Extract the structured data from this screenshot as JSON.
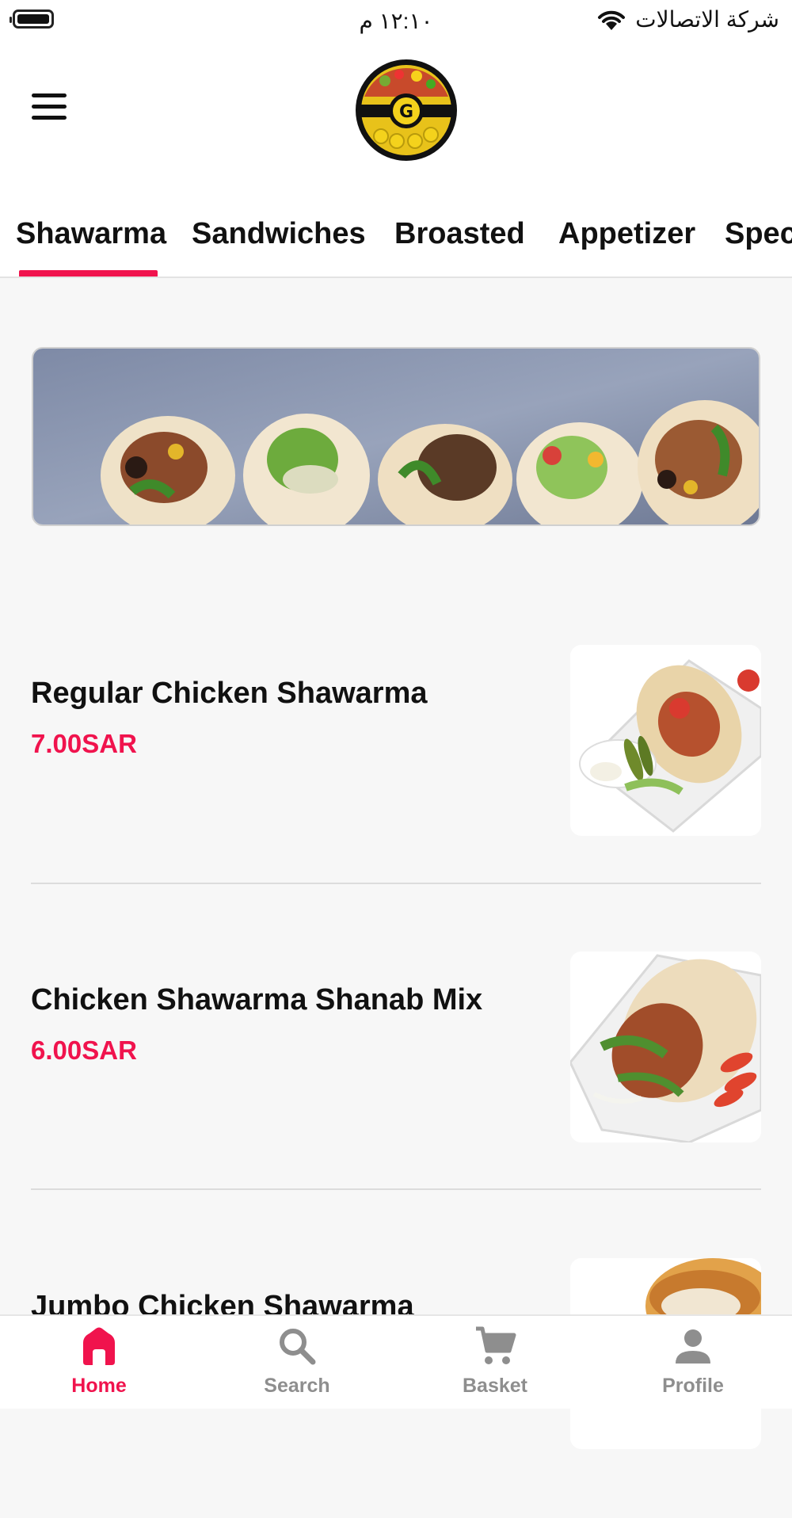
{
  "status_bar": {
    "carrier": "شركة الاتصالات",
    "time": "١٢:١٠ م"
  },
  "header": {
    "menu_icon": "hamburger-icon",
    "logo": "restaurant-logo"
  },
  "tabs": [
    {
      "label": "Shawarma",
      "active": true
    },
    {
      "label": "Sandwiches",
      "active": false
    },
    {
      "label": "Broasted",
      "active": false
    },
    {
      "label": "Appetizer",
      "active": false
    },
    {
      "label": "Spec",
      "active": false
    }
  ],
  "menu_items": [
    {
      "name": "Regular Chicken Shawarma",
      "price": "7.00SAR"
    },
    {
      "name": "Chicken Shawarma Shanab Mix",
      "price": "6.00SAR"
    },
    {
      "name": "Jumbo Chicken Shawarma",
      "price": ""
    }
  ],
  "bottom_nav": [
    {
      "label": "Home",
      "icon": "home-icon",
      "active": true
    },
    {
      "label": "Search",
      "icon": "search-icon",
      "active": false
    },
    {
      "label": "Basket",
      "icon": "cart-icon",
      "active": false
    },
    {
      "label": "Profile",
      "icon": "profile-icon",
      "active": false
    }
  ],
  "colors": {
    "accent": "#f0134d",
    "inactive": "#8e8e8e",
    "background": "#f7f7f7"
  }
}
